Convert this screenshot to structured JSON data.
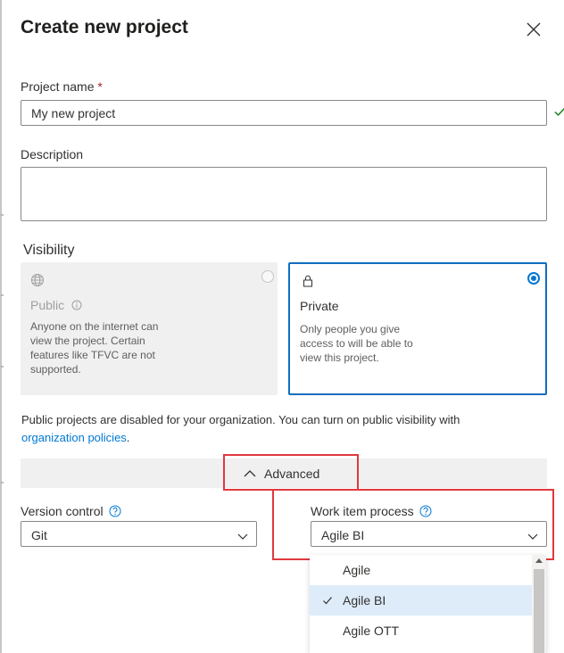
{
  "dialog": {
    "title": "Create new project"
  },
  "project_name": {
    "label": "Project name",
    "required_mark": "*",
    "value": "My new project",
    "valid": true
  },
  "description": {
    "label": "Description",
    "value": ""
  },
  "visibility": {
    "heading": "Visibility",
    "selected": "private",
    "public": {
      "title": "Public",
      "description": "Anyone on the internet can view the project. Certain features like TFVC are not supported.",
      "disabled": true
    },
    "private": {
      "title": "Private",
      "description": "Only people you give access to will be able to view this project."
    }
  },
  "notice": {
    "text": "Public projects are disabled for your organization. You can turn on public visibility with",
    "link": "organization policies",
    "suffix": "."
  },
  "advanced": {
    "label": "Advanced",
    "expanded": true
  },
  "version_control": {
    "label": "Version control",
    "value": "Git"
  },
  "work_item_process": {
    "label": "Work item process",
    "value": "Agile BI",
    "options": [
      {
        "label": "Agile",
        "selected": false
      },
      {
        "label": "Agile BI",
        "selected": true
      },
      {
        "label": "Agile OTT",
        "selected": false
      }
    ]
  },
  "colors": {
    "accent": "#0078d4",
    "highlight_box": "#e0393e",
    "selected_row": "#deecf9",
    "valid_check": "#107c10"
  }
}
